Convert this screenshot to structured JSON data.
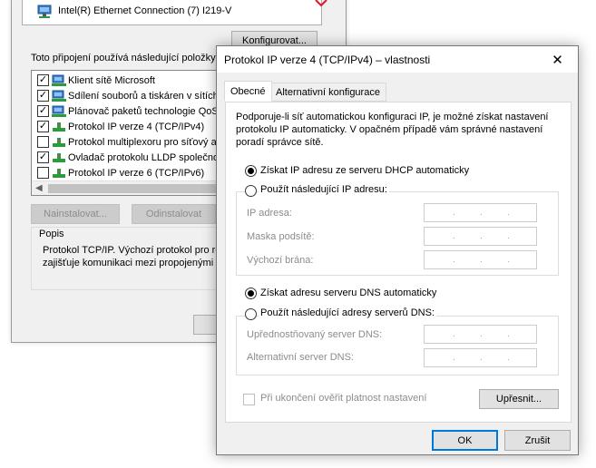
{
  "background_dialog": {
    "adapter_name": "Intel(R) Ethernet Connection (7) I219-V",
    "configure_button": "Konfigurovat...",
    "items_label": "Toto připojení používá následující položky:",
    "items": [
      {
        "label": "Klient sítě Microsoft",
        "checked": true
      },
      {
        "label": "Sdílení souborů a tiskáren v sítích Microsoft",
        "checked": true
      },
      {
        "label": "Plánovač paketů technologie QoS",
        "checked": true
      },
      {
        "label": "Protokol IP verze 4 (TCP/IPv4)",
        "checked": true
      },
      {
        "label": "Protokol multiplexoru pro síťový adaptér",
        "checked": false
      },
      {
        "label": "Ovladač protokolu LLDP společnosti Microsoft",
        "checked": true
      },
      {
        "label": "Protokol IP verze 6 (TCP/IPv6)",
        "checked": false
      }
    ],
    "install_button": "Nainstalovat...",
    "uninstall_button": "Odinstalovat",
    "description_label": "Popis",
    "description_text_1": "Protokol TCP/IP. Výchozí protokol pro rozsáhlé sítě,",
    "description_text_2": "zajišťuje komunikaci mezi propojenými sítěmi."
  },
  "dialog": {
    "title": "Protokol IP verze 4 (TCP/IPv4) – vlastnosti",
    "close_glyph": "✕",
    "tabs": [
      {
        "label": "Obecné",
        "active": true
      },
      {
        "label": "Alternativní konfigurace",
        "active": false
      }
    ],
    "info_line_1": "Podporuje-li síť automatickou konfiguraci IP, je možné získat nastavení",
    "info_line_2": "protokolu IP automaticky. V opačném případě vám správné nastavení",
    "info_line_3": "poradí správce sítě.",
    "ip_auto_label": "Získat IP adresu ze serveru DHCP automaticky",
    "ip_manual_label": "Použít následující IP adresu:",
    "ip_address_label": "IP adresa:",
    "subnet_label": "Maska podsítě:",
    "gateway_label": "Výchozí brána:",
    "dns_auto_label": "Získat adresu serveru DNS automaticky",
    "dns_manual_label": "Použít následující adresy serverů DNS:",
    "preferred_dns_label": "Upřednostňovaný server DNS:",
    "alternate_dns_label": "Alternativní server DNS:",
    "ip_dot": ".",
    "validate_label": "Při ukončení ověřit platnost nastavení",
    "advanced_button": "Upřesnit...",
    "ok_button": "OK",
    "cancel_button": "Zrušit"
  },
  "colors": {
    "accent": "#0078d7",
    "dialog_bg": "#f0f0f0",
    "disabled_text": "#8c8c8c",
    "red_mark": "#e81123"
  }
}
